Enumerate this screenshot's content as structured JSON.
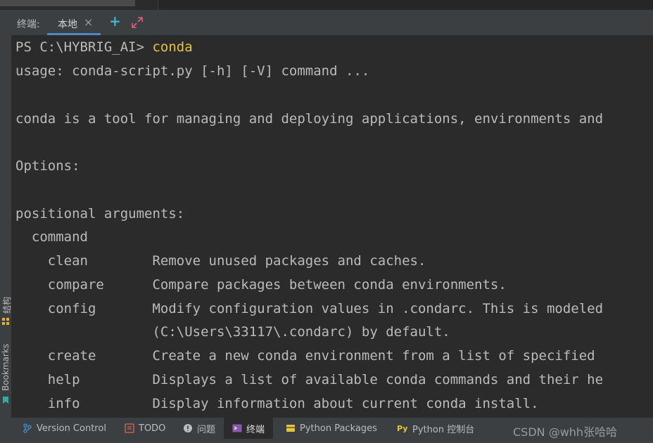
{
  "tabbar": {
    "title": "终端:",
    "active_tab": "本地",
    "close_glyph": "×",
    "new_tab_glyph": "+"
  },
  "sidebar": {
    "structure_label": "结构",
    "bookmarks_label": "Bookmarks"
  },
  "terminal": {
    "prompt": "PS C:\\HYBRIG_AI> ",
    "command": "conda",
    "lines": [
      "usage: conda-script.py [-h] [-V] command ...",
      "",
      "conda is a tool for managing and deploying applications, environments and",
      "",
      "Options:",
      "",
      "positional arguments:",
      "  command",
      "    clean        Remove unused packages and caches.",
      "    compare      Compare packages between conda environments.",
      "    config       Modify configuration values in .condarc. This is modeled",
      "                 (C:\\Users\\33117\\.condarc) by default.",
      "    create       Create a new conda environment from a list of specified",
      "    help         Displays a list of available conda commands and their he",
      "    info         Display information about current conda install."
    ]
  },
  "statusbar": {
    "version_control": "Version Control",
    "todo": "TODO",
    "problems": "问题",
    "terminal": "终端",
    "python_packages": "Python Packages",
    "python_console": "Python 控制台",
    "watermark": "CSDN @whh张哈哈"
  },
  "colors": {
    "accent_tab": "#4a88c7",
    "command_yellow": "#e6c440",
    "plus_cyan": "#3ab6cf"
  }
}
